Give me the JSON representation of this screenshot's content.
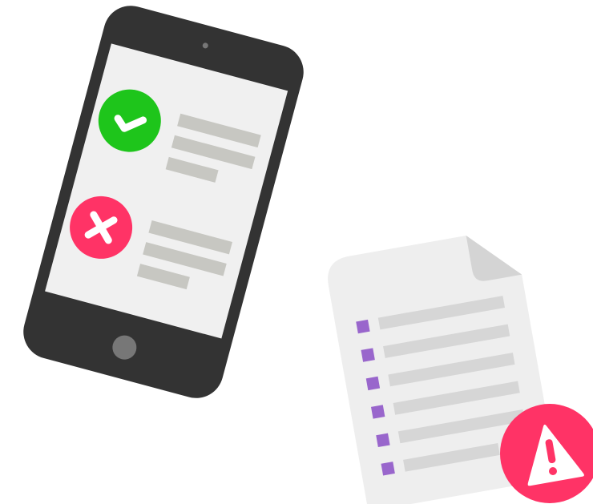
{
  "illustration": {
    "tablet": {
      "body_color": "#333333",
      "screen_color": "#f0f0f0",
      "line_color": "#c7c7c2",
      "home_button_color": "#777777",
      "items": [
        {
          "status": "approved",
          "icon": "check-icon",
          "badge_color": "#1ec51b",
          "lines": 3
        },
        {
          "status": "rejected",
          "icon": "close-icon",
          "badge_color": "#ff3366",
          "lines": 3
        }
      ]
    },
    "document": {
      "paper_color": "#eeeeee",
      "fold_color": "#d4d4d4",
      "line_color": "#d6d6d6",
      "bullet_color": "#9966cc",
      "rows": 6,
      "alert": {
        "icon": "warning-icon",
        "badge_color": "#ff3366",
        "glyph": "!"
      }
    }
  }
}
